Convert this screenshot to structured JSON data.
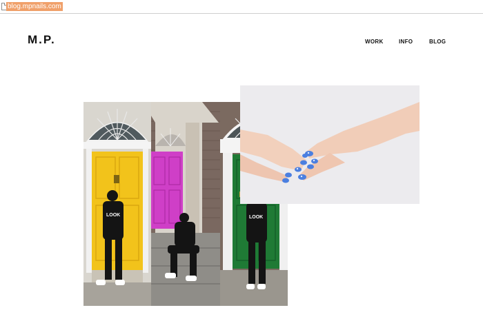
{
  "browser": {
    "url": "blog.mpnails.com"
  },
  "site": {
    "logo": "M.P.",
    "nav": [
      {
        "label": "WORK"
      },
      {
        "label": "INFO"
      },
      {
        "label": "BLOG"
      }
    ]
  },
  "gallery": {
    "items": [
      {
        "subject": "three-door-photo-collage",
        "door_colors": [
          "#f2c31b",
          "#cf3fc7",
          "#1f7a35"
        ],
        "hoodie_text": "LOOK"
      },
      {
        "subject": "blue-nail-art-hands-photo",
        "nail_color": "#4b7fe0"
      }
    ]
  },
  "colors": {
    "url_highlight": "#f0a06a",
    "text": "#111111",
    "background": "#ffffff"
  }
}
